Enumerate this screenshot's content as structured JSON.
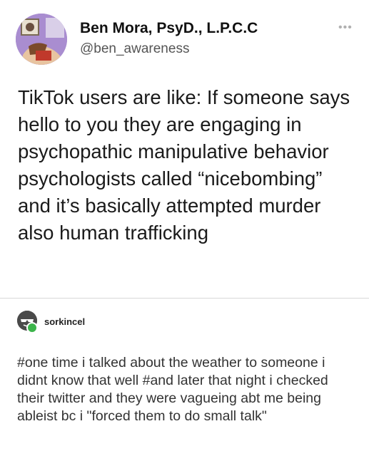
{
  "tweet": {
    "display_name": "Ben Mora, PsyD., L.P.C.C",
    "handle": "@ben_awareness",
    "more_icon": "more-dots-icon",
    "text": "TikTok users are like: If someone says hello to you they are engaging in psychopathic manipulative behavior psychologists called “nicebombing” and it’s basically attempted murder also human trafficking"
  },
  "post": {
    "username": "sorkincel",
    "badge_color": "#3cb44b",
    "text": "#one time i talked about the weather to someone i didnt know that well  #and later that night i checked their twitter and they were vagueing abt me being ableist bc i \"forced them to do small talk\""
  }
}
